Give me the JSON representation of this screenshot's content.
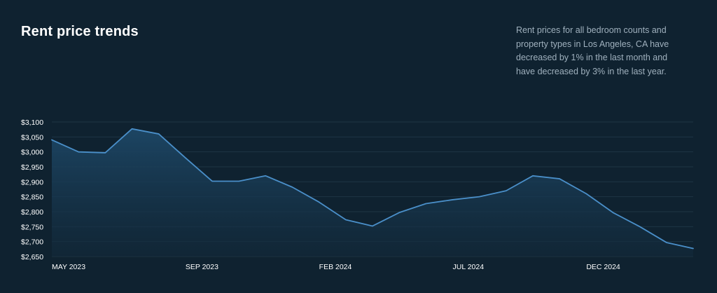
{
  "header": {
    "title": "Rent price trends",
    "description": "Rent prices for all bedroom counts and property types in Los Angeles, CA have decreased by 1% in the last month and have decreased by 3% in the last year."
  },
  "colors": {
    "background": "#0f2230",
    "line": "#4a8fc9",
    "grid": "#1f3544"
  },
  "chart_data": {
    "type": "area",
    "title": "Rent price trends",
    "xlabel": "",
    "ylabel": "",
    "ylim": [
      2650,
      3100
    ],
    "yticks": [
      2650,
      2700,
      2750,
      2800,
      2850,
      2900,
      2950,
      3000,
      3050,
      3100
    ],
    "ytick_labels": [
      "$2,650",
      "$2,700",
      "$2,750",
      "$2,800",
      "$2,850",
      "$2,900",
      "$2,950",
      "$3,000",
      "$3,050",
      "$3,100"
    ],
    "xtick_labels": [
      {
        "label": "MAY 2023",
        "index": 0
      },
      {
        "label": "SEP 2023",
        "index": 5
      },
      {
        "label": "FEB 2024",
        "index": 10
      },
      {
        "label": "JUL 2024",
        "index": 15
      },
      {
        "label": "DEC 2024",
        "index": 20
      }
    ],
    "grid": true,
    "legend": "none",
    "series": [
      {
        "values": [
          3040,
          3000,
          2997,
          3077,
          3060,
          2980,
          2902,
          2902,
          2920,
          2882,
          2832,
          2773,
          2752,
          2797,
          2827,
          2840,
          2850,
          2870,
          2920,
          2910,
          2860,
          2797,
          2750,
          2697,
          2677
        ]
      }
    ]
  }
}
